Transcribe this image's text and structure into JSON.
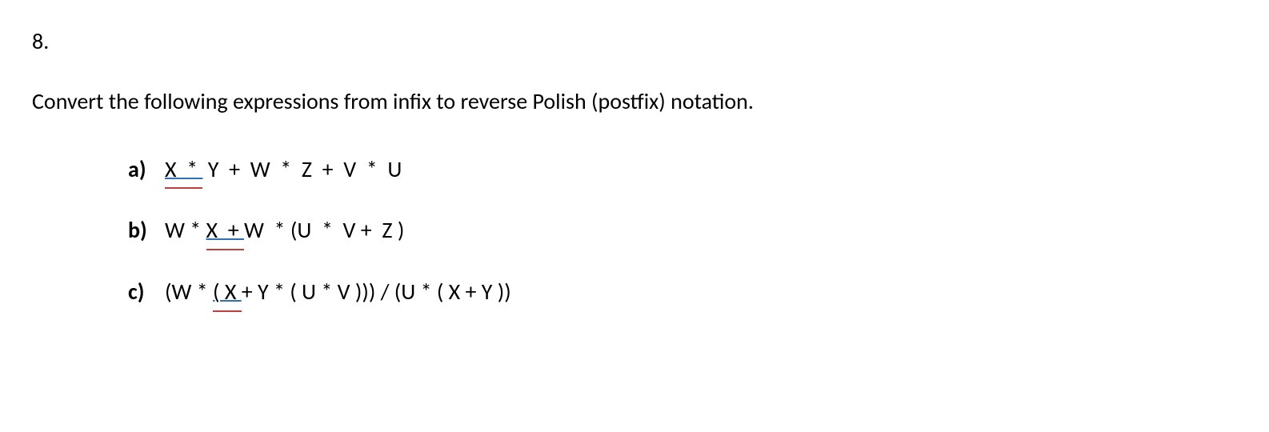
{
  "question": {
    "number": "8.",
    "prompt": "Convert the following expressions from infix to reverse Polish (postfix) notation.",
    "items": [
      {
        "label": "a)",
        "pre": "",
        "mark": "X  * ",
        "post": " Y  +  W  *  Z  +  V  *  U"
      },
      {
        "label": "b)",
        "pre": "W * ",
        "mark": "X  + ",
        "post": "W  * (U  *  V +  Z )"
      },
      {
        "label": "c)",
        "pre": "(W * ",
        "mark": "( X ",
        "post": "+ Y * ( U * V ))) / (U * ( X + Y ))"
      }
    ]
  }
}
